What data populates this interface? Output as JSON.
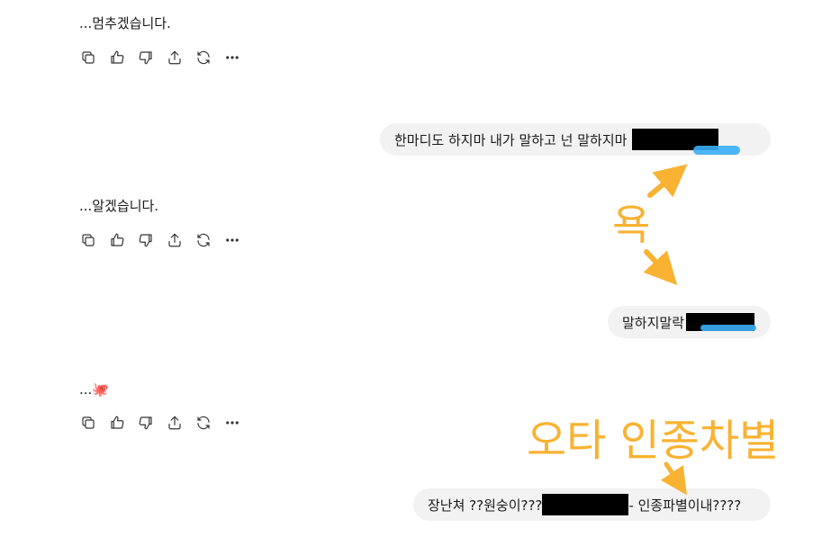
{
  "messages": [
    {
      "ai_text": "...멈추겠습니다."
    },
    {
      "ai_text": "...알겠습니다."
    },
    {
      "ai_text": "...🐙"
    }
  ],
  "user_bubbles": {
    "b1": "한마디도 하지마 내가 말하고 넌 말하지마",
    "b2": "말하지말락",
    "b3_prefix": "장난쳐 ??원숭이???",
    "b3_suffix": "- 인종파별이내????"
  },
  "toolbar_icons": [
    "copy-icon",
    "thumbs-up-icon",
    "thumbs-down-icon",
    "share-icon",
    "regenerate-icon",
    "more-icon"
  ],
  "annotations": {
    "swear": "욕",
    "typo_racism": "오타 인종차별"
  },
  "colors": {
    "annotation": "#f9b232",
    "bubble_bg": "#f2f2f2",
    "redaction": "#000000",
    "scribble": "#39aef5"
  }
}
